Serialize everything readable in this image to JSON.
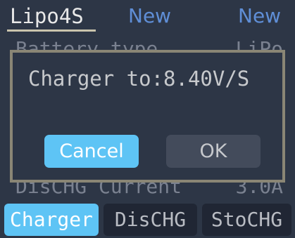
{
  "tabs": {
    "profile": "Lipo4S",
    "new1": "New",
    "new2": "New"
  },
  "list": {
    "battery_type_label": "Battery type",
    "battery_type_value": "LiPo",
    "dischg_current_label": "DisCHG Current",
    "dischg_current_value": "3.0A"
  },
  "dialog": {
    "message": "Charger to:8.40V/S",
    "cancel_label": "Cancel",
    "ok_label": "OK"
  },
  "bottom_tabs": {
    "charger": "Charger",
    "dischg": "DisCHG",
    "stochg": "StoCHG"
  },
  "colors": {
    "accent": "#5ec4f5",
    "background": "#2d3646",
    "dialog_border": "#8a8675",
    "tab_link": "#5f8ed6"
  }
}
